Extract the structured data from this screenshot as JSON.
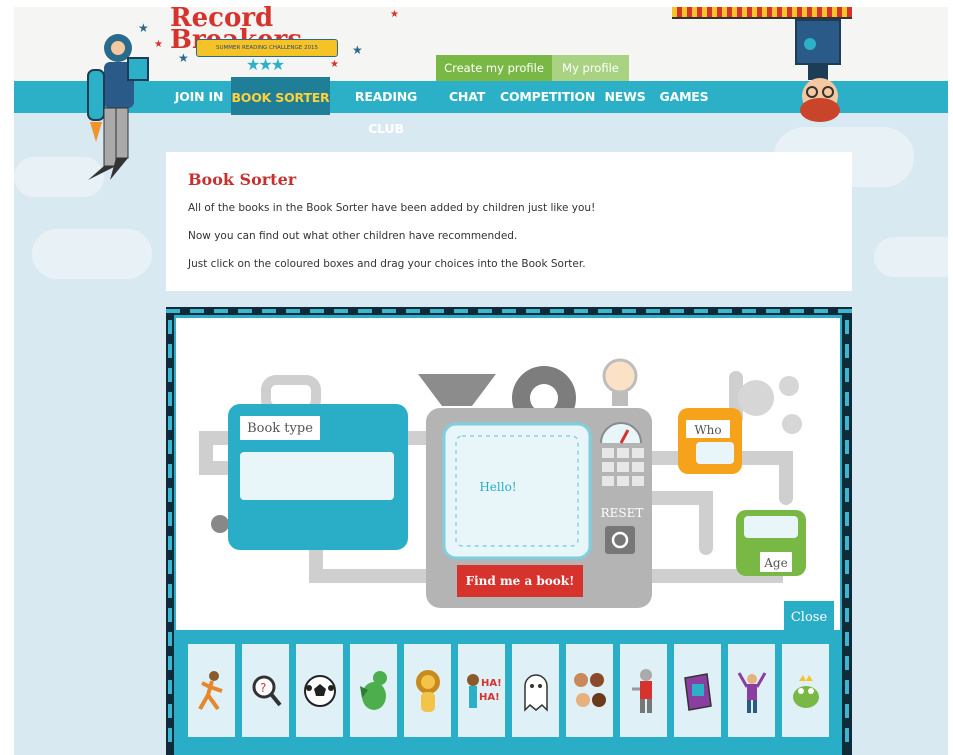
{
  "header": {
    "logo_title": "Record Breakers",
    "logo_banner": "SUMMER READING CHALLENGE 2015"
  },
  "profile_tabs": {
    "create": "Create my profile",
    "my": "My profile"
  },
  "nav": [
    {
      "label": "JOIN IN"
    },
    {
      "label": "BOOK SORTER"
    },
    {
      "label": "READING CLUB"
    },
    {
      "label": "CHAT"
    },
    {
      "label": "COMPETITION"
    },
    {
      "label": "NEWS"
    },
    {
      "label": "GAMES"
    }
  ],
  "intro": {
    "title": "Book Sorter",
    "p1": "All of the books in the Book Sorter have been added by children just like you!",
    "p2": "Now you can find out what other children have recommended.",
    "p3": "Just click on the coloured boxes and drag your choices into the Book Sorter."
  },
  "sorter": {
    "book_type_label": "Book type",
    "screen_text": "Hello!",
    "reset_label": "RESET",
    "find_button": "Find me a book!",
    "who_label": "Who",
    "age_label": "Age",
    "close_label": "Close"
  },
  "tiles": [
    {
      "icon": "running-figure-icon"
    },
    {
      "icon": "magnifying-glass-icon"
    },
    {
      "icon": "football-icon"
    },
    {
      "icon": "dragon-icon"
    },
    {
      "icon": "lion-icon"
    },
    {
      "icon": "laughing-figure-icon"
    },
    {
      "icon": "ghost-icon"
    },
    {
      "icon": "group-of-children-icon"
    },
    {
      "icon": "knight-icon"
    },
    {
      "icon": "book-icon"
    },
    {
      "icon": "cheering-figure-icon"
    },
    {
      "icon": "frog-prince-icon"
    }
  ],
  "colors": {
    "nav_bg": "#2bb0c7",
    "nav_active_bg": "#1f7f98",
    "nav_active_text": "#ffd13a",
    "create_tab": "#7ab845",
    "my_tab": "#a9d382",
    "title_red": "#c8302e",
    "find_button": "#d7332d",
    "who_box": "#f7a21b",
    "age_box": "#7ab845",
    "machine_grey": "#b7b7b7"
  }
}
